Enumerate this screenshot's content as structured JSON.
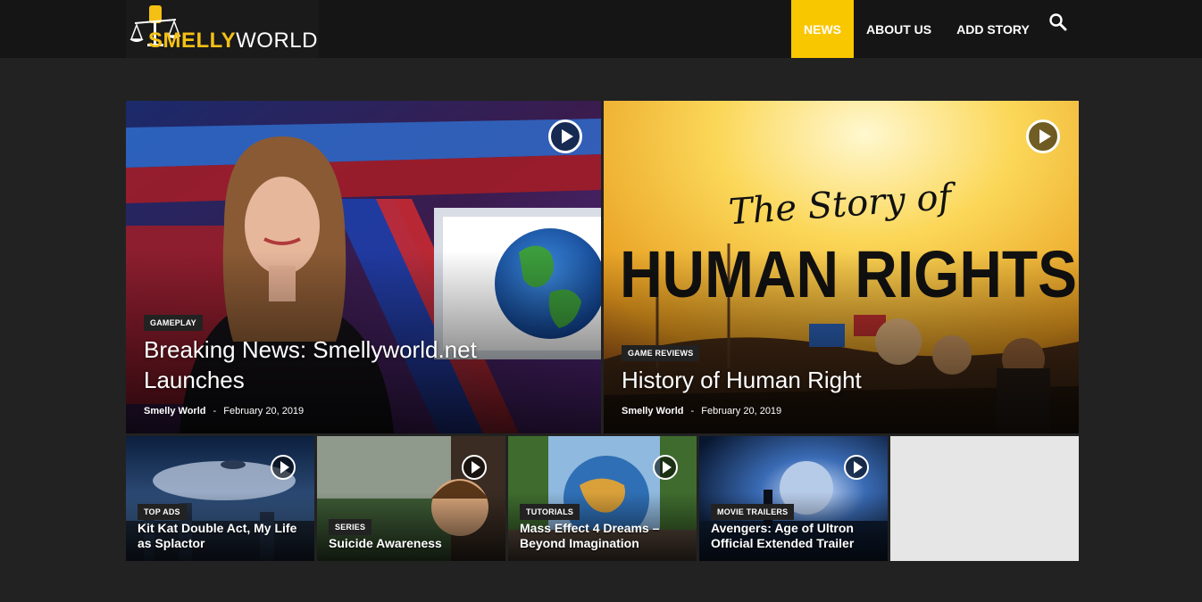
{
  "header": {
    "logo": {
      "part1": "SMELLY",
      "part2": "WORLD"
    },
    "nav": [
      "NEWS",
      "ABOUT US",
      "ADD STORY"
    ],
    "active_nav": "NEWS"
  },
  "featured": [
    {
      "category": "GAMEPLAY",
      "title_line1": "Breaking News: Smellyworld.net",
      "title_line2": "Launches",
      "author": "Smelly World",
      "separator": "-",
      "date": "February 20, 2019"
    },
    {
      "category": "GAME REVIEWS",
      "title": "History of Human Right",
      "author": "Smelly World",
      "separator": "-",
      "date": "February 20, 2019",
      "art_line1": "The Story of",
      "art_line2": "HUMAN RIGHTS"
    }
  ],
  "small": [
    {
      "category": "TOP ADS",
      "title_line1": "Kit Kat Double Act, My Life",
      "title_line2": "as Splactor"
    },
    {
      "category": "SERIES",
      "title_line1": "Suicide Awareness",
      "title_line2": ""
    },
    {
      "category": "TUTORIALS",
      "title_line1": "Mass Effect 4 Dreams –",
      "title_line2": "Beyond Imagination"
    },
    {
      "category": "MOVIE TRAILERS",
      "title_line1": "Avengers: Age of Ultron",
      "title_line2": "Official Extended Trailer"
    }
  ],
  "colors": {
    "accent": "#f9c700",
    "background": "#222222",
    "header": "#151515"
  }
}
